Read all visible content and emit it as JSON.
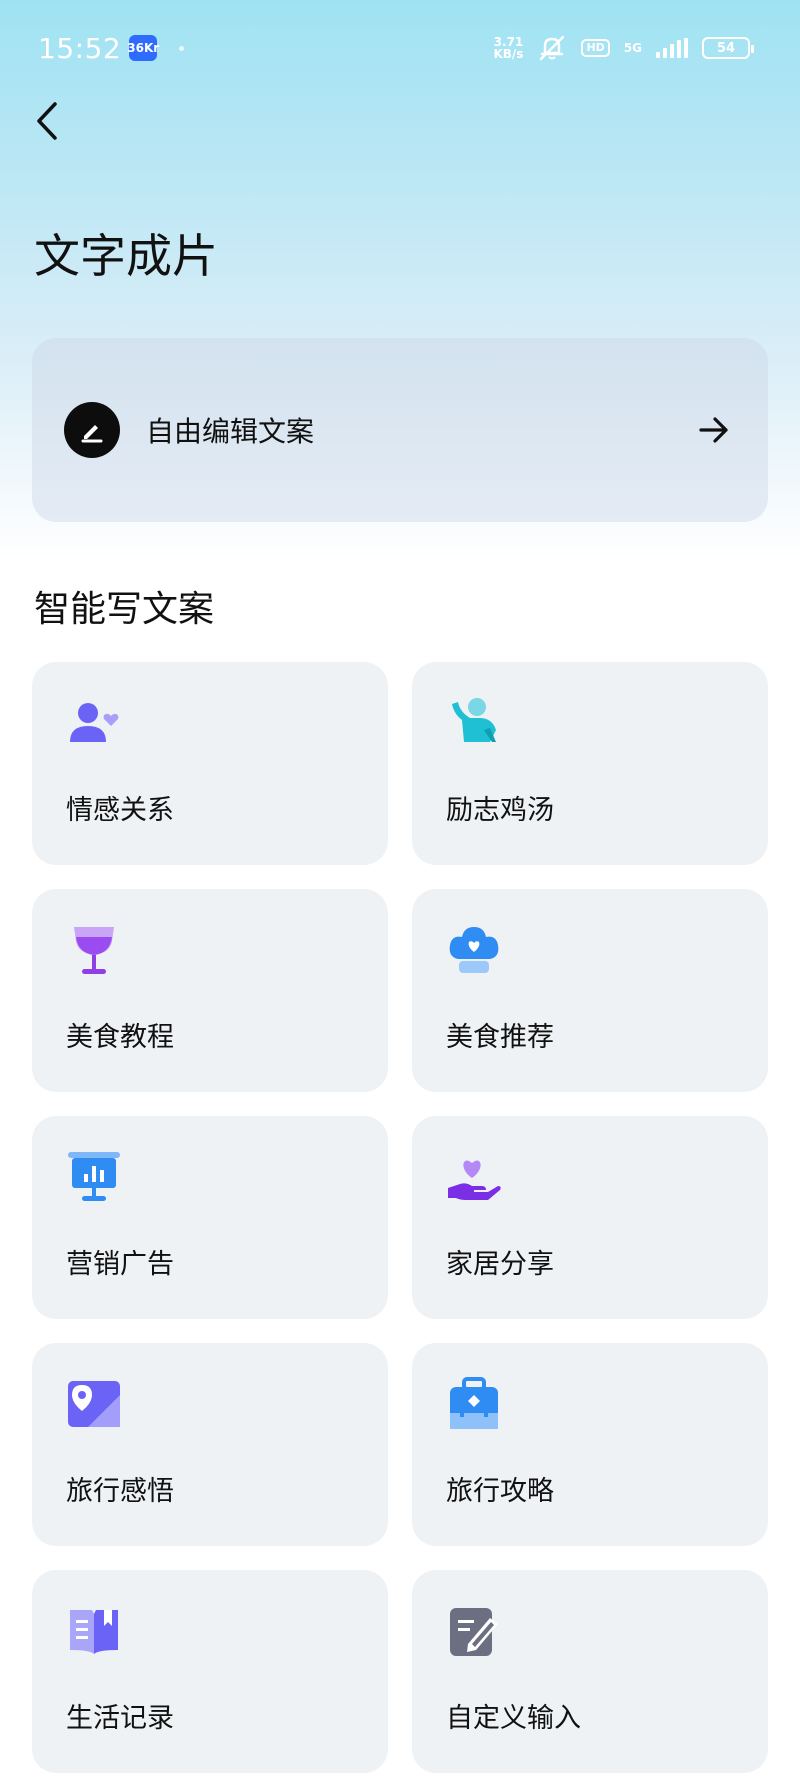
{
  "status_bar": {
    "time": "15:52",
    "app_badge": "36Kr",
    "net_speed_value": "3.71",
    "net_speed_unit": "KB/s",
    "hd": "HD",
    "network": "5G",
    "battery": "54"
  },
  "header": {
    "title": "文字成片"
  },
  "free_edit": {
    "label": "自由编辑文案"
  },
  "section": {
    "title": "智能写文案"
  },
  "categories": [
    {
      "label": "情感关系",
      "icon": "person-heart-icon",
      "color": "#6a63f6"
    },
    {
      "label": "励志鸡汤",
      "icon": "waving-person-icon",
      "color": "#22c1d6"
    },
    {
      "label": "美食教程",
      "icon": "wine-glass-icon",
      "color": "#9b4cf0"
    },
    {
      "label": "美食推荐",
      "icon": "chef-hat-icon",
      "color": "#2e8cf3"
    },
    {
      "label": "营销广告",
      "icon": "presentation-board-icon",
      "color": "#2e8cf3"
    },
    {
      "label": "家居分享",
      "icon": "hand-heart-icon",
      "color": "#8b3ff0"
    },
    {
      "label": "旅行感悟",
      "icon": "map-pin-photo-icon",
      "color": "#6a63f6"
    },
    {
      "label": "旅行攻略",
      "icon": "suitcase-icon",
      "color": "#2e8cf3"
    },
    {
      "label": "生活记录",
      "icon": "open-book-icon",
      "color": "#8580f5"
    },
    {
      "label": "自定义输入",
      "icon": "edit-note-icon",
      "color": "#6c6f82"
    }
  ]
}
